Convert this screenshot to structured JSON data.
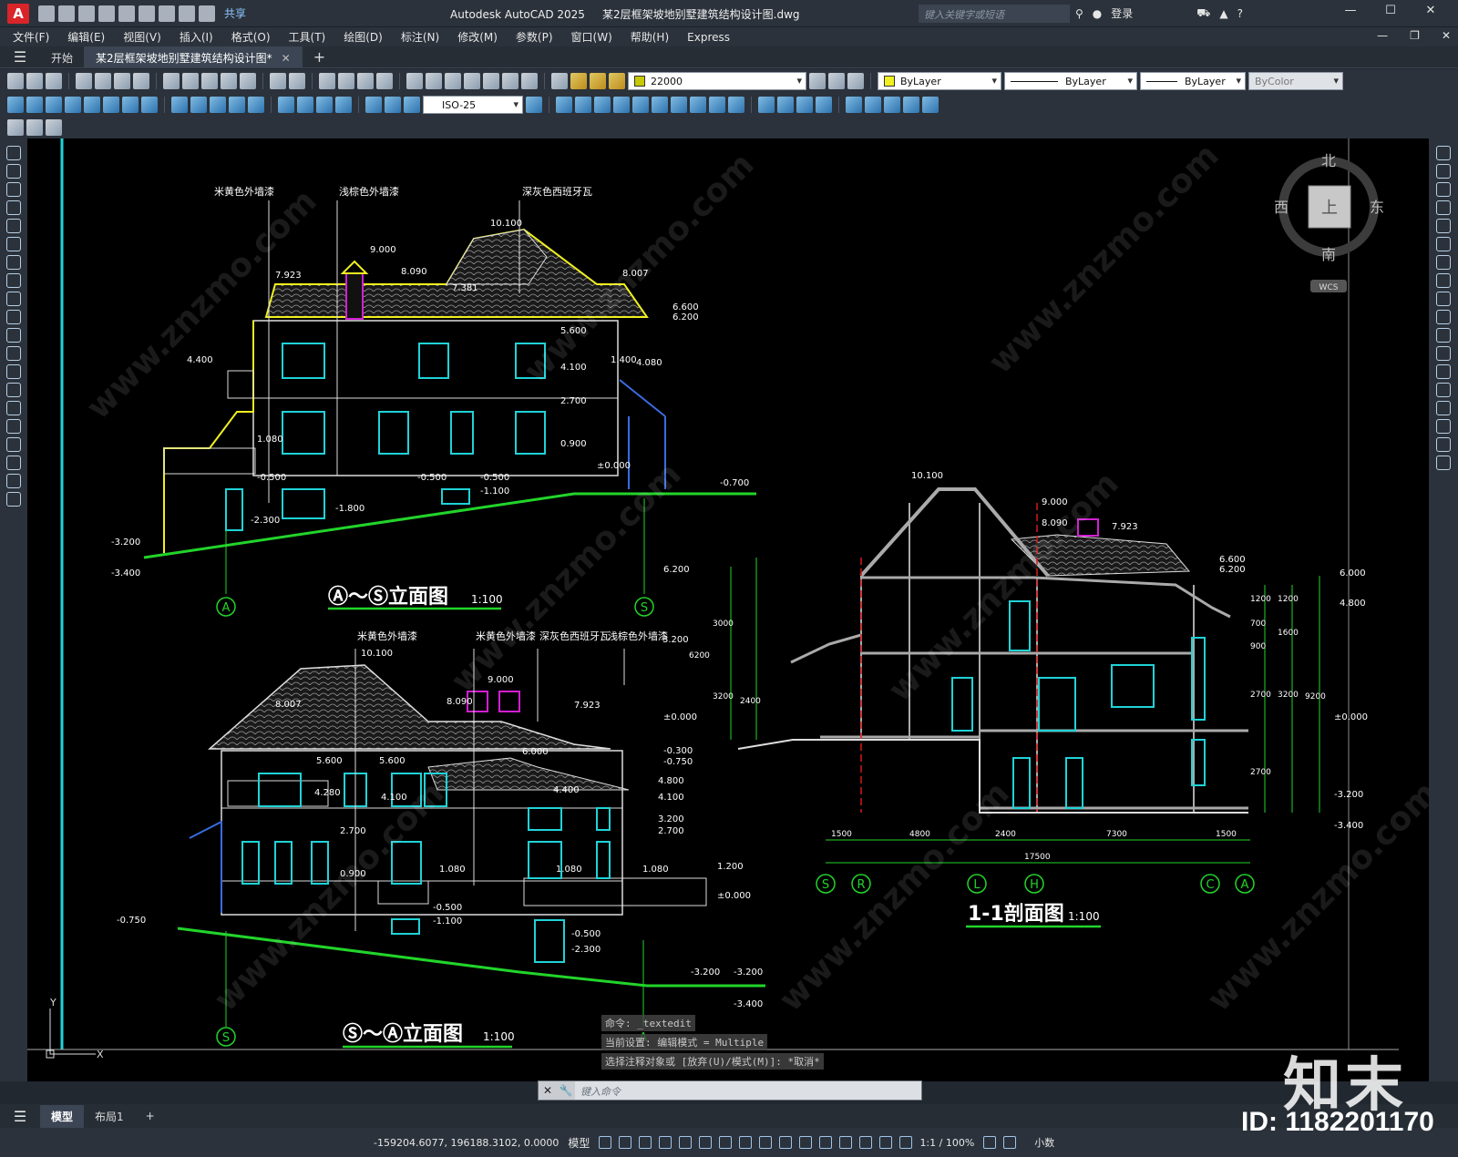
{
  "window": {
    "app_name": "Autodesk AutoCAD 2025",
    "file_name": "某2层框架坡地别墅建筑结构设计图.dwg",
    "share_label": "共享",
    "search_placeholder": "键入关键字或短语",
    "login_label": "登录"
  },
  "menu": [
    "文件(F)",
    "编辑(E)",
    "视图(V)",
    "插入(I)",
    "格式(O)",
    "工具(T)",
    "绘图(D)",
    "标注(N)",
    "修改(M)",
    "参数(P)",
    "窗口(W)",
    "帮助(H)",
    "Express"
  ],
  "doc_tabs": {
    "start_label": "开始",
    "active_label": "某2层框架坡地别墅建筑结构设计图*"
  },
  "properties": {
    "layer_value": "22000",
    "color_value": "ByLayer",
    "linetype_value": "ByLayer",
    "lineweight_value": "ByLayer",
    "plotstyle_value": "ByColor",
    "dim_style": "ISO-25"
  },
  "colors": {
    "accent_green": "#22d42a",
    "accent_cyan": "#1fd3d8",
    "accent_yellow": "#f0f020",
    "accent_magenta": "#d21fd2"
  },
  "viewcube": {
    "north": "北",
    "south": "南",
    "east": "东",
    "west": "西",
    "top": "上",
    "wcs": "WCS"
  },
  "drawing": {
    "elev1": {
      "title": "Ⓐ～Ⓢ立面图",
      "scale": "1:100",
      "notes": [
        "米黄色外墙漆",
        "浅棕色外墙漆",
        "深灰色西班牙瓦"
      ],
      "levels": [
        "10.100",
        "9.000",
        "8.090",
        "7.923",
        "7.381",
        "8.007",
        "6.600",
        "6.200",
        "5.600",
        "4.400",
        "4.100",
        "4.080",
        "1.400",
        "2.700",
        "1.080",
        "0.900",
        "±0.000",
        "-0.500",
        "-0.500",
        "-0.500",
        "-0.700",
        "-1.100",
        "-1.800",
        "-2.300",
        "-3.200",
        "-3.400"
      ],
      "axes": [
        "A",
        "S"
      ]
    },
    "elev2": {
      "title": "Ⓢ～Ⓐ立面图",
      "scale": "1:100",
      "notes": [
        "米黄色外墙漆",
        "米黄色外墙漆",
        "深灰色西班牙瓦",
        "浅棕色外墙漆"
      ],
      "levels": [
        "10.100",
        "9.000",
        "8.090",
        "7.923",
        "8.007",
        "6.000",
        "5.600",
        "5.600",
        "4.800",
        "4.400",
        "4.280",
        "4.100",
        "4.100",
        "3.200",
        "3.200",
        "2.700",
        "2.700",
        "1.200",
        "1.080",
        "1.080",
        "1.080",
        "0.900",
        "±0.000",
        "-0.500",
        "-0.500",
        "-0.750",
        "-1.100",
        "-2.300",
        "-3.200",
        "-3.200",
        "-3.400"
      ],
      "axes": [
        "S",
        "A"
      ]
    },
    "section": {
      "title": "1-1剖面图",
      "scale": "1:100",
      "levels": [
        "10.100",
        "9.000",
        "8.090",
        "7.923",
        "6.600",
        "6.200",
        "6.200",
        "6.000",
        "4.800",
        "±0.000",
        "±0.000",
        "-0.300",
        "-0.750",
        "-3.200",
        "-3.400"
      ],
      "dims_bottom": [
        "1500",
        "4800",
        "2400",
        "7300",
        "1500"
      ],
      "dim_total": "17500",
      "dims_left": [
        "3000",
        "3200",
        "2400",
        "6200"
      ],
      "dims_right": [
        "1200",
        "1200",
        "700",
        "1600",
        "900",
        "2700",
        "3200",
        "2700",
        "9200"
      ],
      "axes": [
        "S",
        "R",
        "L",
        "H",
        "C",
        "A"
      ]
    }
  },
  "command": {
    "history": [
      "命令: _textedit",
      "当前设置: 编辑模式 = Multiple",
      "选择注释对象或 [放弃(U)/模式(M)]: *取消*"
    ],
    "placeholder": "键入命令"
  },
  "layout_tabs": [
    "模型",
    "布局1"
  ],
  "status": {
    "coords": "-159204.6077, 196188.3102, 0.0000",
    "mode": "模型",
    "scale": "1:1 / 100%",
    "units": "小数"
  },
  "watermark": {
    "logo": "知末",
    "id": "ID: 1182201170",
    "site": "www.znzmo.com"
  }
}
